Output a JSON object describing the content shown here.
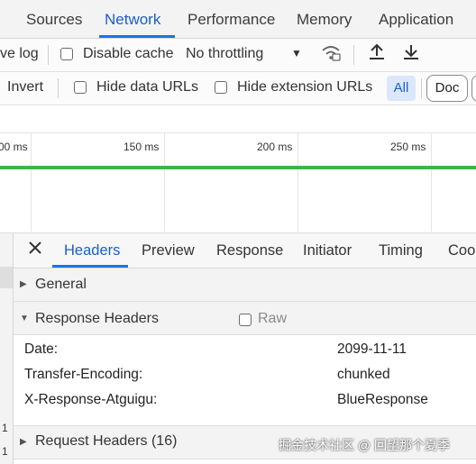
{
  "tabs": [
    "Sources",
    "Network",
    "Performance",
    "Memory",
    "Application"
  ],
  "active_tab": "Network",
  "toolbar1": {
    "preserve_log_partial": "ve log",
    "disable_cache": "Disable cache",
    "throttling": "No throttling"
  },
  "toolbar2": {
    "invert": "Invert",
    "hide_data_urls": "Hide data URLs",
    "hide_extension_urls": "Hide extension URLs",
    "filter_all": "All",
    "filter_doc": "Doc"
  },
  "timeline": {
    "ticks": [
      "00 ms",
      "150 ms",
      "200 ms",
      "250 ms"
    ]
  },
  "details": {
    "tabs": [
      "Headers",
      "Preview",
      "Response",
      "Initiator",
      "Timing",
      "Coo"
    ],
    "active_tab": "Headers",
    "general": "General",
    "response_headers": {
      "title": "Response Headers",
      "raw_label": "Raw",
      "rows": [
        {
          "name": "Date:",
          "value": "2099-11-11"
        },
        {
          "name": "Transfer-Encoding:",
          "value": "chunked"
        },
        {
          "name": "X-Response-Atguigu:",
          "value": "BlueResponse"
        }
      ]
    },
    "request_headers": "Request Headers (16)"
  },
  "left_pane_glyphs": [
    "1",
    "1",
    "1"
  ],
  "watermark": "掘金技术社区 @ 回望那个夏季",
  "colors": {
    "accent": "#1a73e8",
    "timeline_bar": "#3cb44b"
  }
}
